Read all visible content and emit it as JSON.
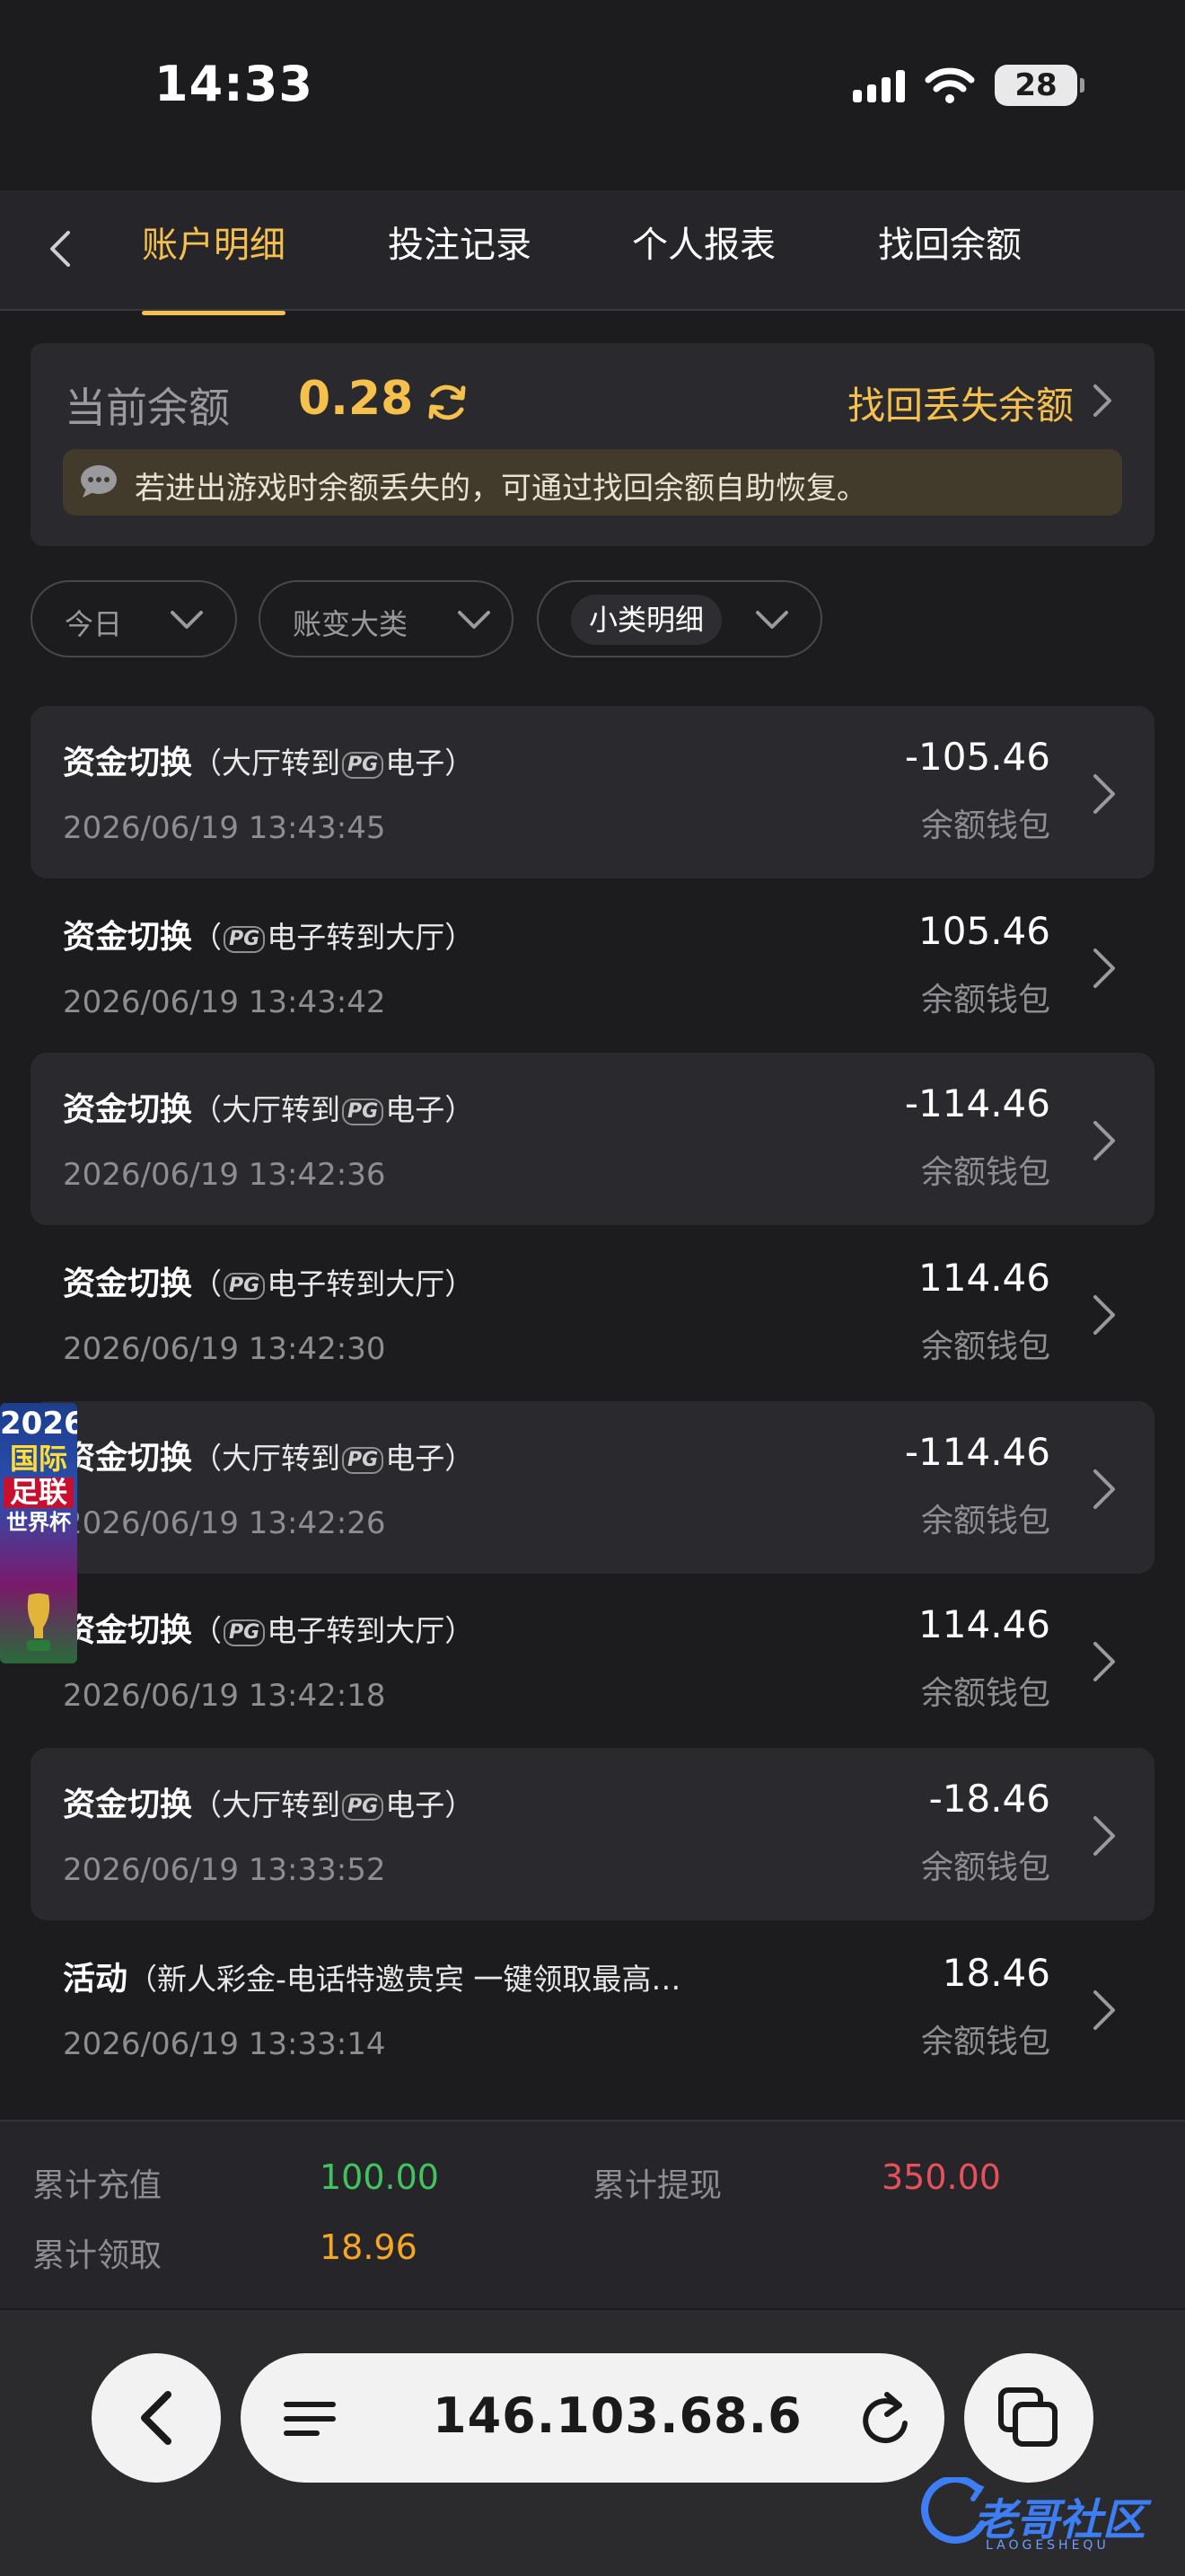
{
  "status_bar": {
    "time": "14:33",
    "battery": "28"
  },
  "nav": {
    "tabs": [
      {
        "label": "账户明细",
        "active": true
      },
      {
        "label": "投注记录",
        "active": false
      },
      {
        "label": "个人报表",
        "active": false
      },
      {
        "label": "找回余额",
        "active": false
      }
    ]
  },
  "balance": {
    "label": "当前余额",
    "value": "0.28",
    "recover_link": "找回丢失余额",
    "notice": "若进出游戏时余额丢失的，可通过找回余额自助恢复。"
  },
  "filters": [
    {
      "label": "今日"
    },
    {
      "label": "账变大类"
    },
    {
      "label": "小类明细"
    }
  ],
  "transactions": [
    {
      "title": "资金切换",
      "detail_pre": "（大厅转到",
      "pg": "PG",
      "detail_post": "电子）",
      "time": "2026/06/19 13:43:45",
      "amount": "-105.46",
      "wallet": "余额钱包"
    },
    {
      "title": "资金切换",
      "detail_pre": "（",
      "pg": "PG",
      "detail_post": "电子转到大厅）",
      "time": "2026/06/19 13:43:42",
      "amount": "105.46",
      "wallet": "余额钱包"
    },
    {
      "title": "资金切换",
      "detail_pre": "（大厅转到",
      "pg": "PG",
      "detail_post": "电子）",
      "time": "2026/06/19 13:42:36",
      "amount": "-114.46",
      "wallet": "余额钱包"
    },
    {
      "title": "资金切换",
      "detail_pre": "（",
      "pg": "PG",
      "detail_post": "电子转到大厅）",
      "time": "2026/06/19 13:42:30",
      "amount": "114.46",
      "wallet": "余额钱包"
    },
    {
      "title": "资金切换",
      "detail_pre": "（大厅转到",
      "pg": "PG",
      "detail_post": "电子）",
      "time": "2026/06/19 13:42:26",
      "amount": "-114.46",
      "wallet": "余额钱包"
    },
    {
      "title": "资金切换",
      "detail_pre": "（",
      "pg": "PG",
      "detail_post": "电子转到大厅）",
      "time": "2026/06/19 13:42:18",
      "amount": "114.46",
      "wallet": "余额钱包"
    },
    {
      "title": "资金切换",
      "detail_pre": "（大厅转到",
      "pg": "PG",
      "detail_post": "电子）",
      "time": "2026/06/19 13:33:52",
      "amount": "-18.46",
      "wallet": "余额钱包"
    },
    {
      "title": "活动",
      "detail_pre": "（新人彩金-电话特邀贵宾 一键领取最高…",
      "pg": "",
      "detail_post": "",
      "time": "2026/06/19 13:33:14",
      "amount": "18.46",
      "wallet": "余额钱包"
    }
  ],
  "ad_banner": {
    "year": "2026",
    "line1": "国际",
    "line2": "足联",
    "line3": "世界杯"
  },
  "summary": {
    "recharge_label": "累计充值",
    "recharge_value": "100.00",
    "withdraw_label": "累计提现",
    "withdraw_value": "350.00",
    "claim_label": "累计领取",
    "claim_value": "18.96"
  },
  "browser": {
    "url": "146.103.68.6"
  },
  "watermark": {
    "text": "老哥社区",
    "sub": "LAOGESHEQU"
  },
  "colors": {
    "accent": "#f5c04c",
    "positive": "#41c45e",
    "negative": "#e8505b",
    "background": "#1c1c1f",
    "card": "#2a2a2e"
  }
}
